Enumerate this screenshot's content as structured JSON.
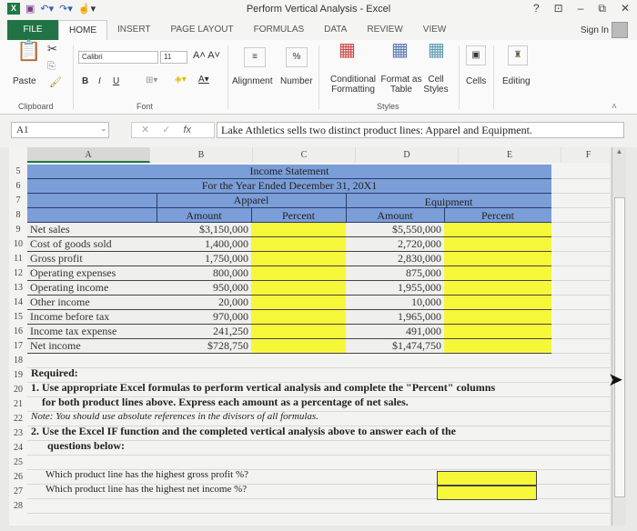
{
  "window": {
    "title": "Perform Vertical Analysis - Excel",
    "controls": [
      "?",
      "⊡",
      "–",
      "⧉",
      "✕"
    ],
    "sign_in": "Sign In"
  },
  "qat": {
    "logo": "X",
    "icons": [
      "save-icon",
      "undo-icon",
      "redo-icon",
      "touch-mode-icon"
    ]
  },
  "tabs": [
    "FILE",
    "HOME",
    "INSERT",
    "PAGE LAYOUT",
    "FORMULAS",
    "DATA",
    "REVIEW",
    "VIEW"
  ],
  "active_tab": "HOME",
  "ribbon": {
    "clipboard": {
      "paste": "Paste",
      "label": "Clipboard"
    },
    "font": {
      "name": "Calibri",
      "size": "11",
      "bold": "B",
      "italic": "I",
      "underline": "U",
      "label": "Font"
    },
    "alignment": "Alignment",
    "number": "Number",
    "number_symbol": "%",
    "styles": {
      "conditional": "Conditional Formatting",
      "format_table": "Format as Table",
      "cell_styles": "Cell Styles",
      "label": "Styles"
    },
    "cells": "Cells",
    "editing": "Editing"
  },
  "formula_bar": {
    "name_box": "A1",
    "formula": "Lake Athletics sells two distinct product lines:  Apparel and Equipment.",
    "fx": "fx"
  },
  "columns": [
    "A",
    "B",
    "C",
    "D",
    "E",
    "F"
  ],
  "sheet": {
    "title": "Income Statement",
    "subtitle": "For the Year Ended December 31, 20X1",
    "apparel": "Apparel",
    "equipment": "Equipment",
    "amount_hdr": "Amount",
    "percent_hdr": "Percent",
    "rows": [
      {
        "n": "9",
        "label": "Net sales",
        "apparel": "$3,150,000",
        "equipment": "$5,550,000"
      },
      {
        "n": "10",
        "label": "Cost of goods sold",
        "apparel": "1,400,000",
        "equipment": "2,720,000"
      },
      {
        "n": "11",
        "label": "Gross profit",
        "apparel": "1,750,000",
        "equipment": "2,830,000"
      },
      {
        "n": "12",
        "label": "Operating expenses",
        "apparel": "800,000",
        "equipment": "875,000"
      },
      {
        "n": "13",
        "label": "Operating income",
        "apparel": "950,000",
        "equipment": "1,955,000"
      },
      {
        "n": "14",
        "label": "Other income",
        "apparel": "20,000",
        "equipment": "10,000"
      },
      {
        "n": "15",
        "label": "Income before tax",
        "apparel": "970,000",
        "equipment": "1,965,000"
      },
      {
        "n": "16",
        "label": "Income tax expense",
        "apparel": "241,250",
        "equipment": "491,000"
      },
      {
        "n": "17",
        "label": "Net income",
        "apparel": "$728,750",
        "equipment": "$1,474,750"
      }
    ],
    "required": "Required:",
    "q1a": "1. Use appropriate Excel formulas to perform vertical analysis and complete the \"Percent\" columns",
    "q1b": "for both product lines above.  Express each amount as a percentage of net sales.",
    "note": "Note:  You should use absolute references in the divisors of all formulas.",
    "q2a": "2.  Use the Excel IF function and the completed vertical analysis above to answer each of the",
    "q2b": "questions below:",
    "ask1": "Which product line has the highest gross profit %?",
    "ask2": "Which product line has the highest net income %?"
  },
  "row_numbers": [
    "5",
    "6",
    "7",
    "8",
    "9",
    "10",
    "11",
    "12",
    "13",
    "14",
    "15",
    "16",
    "17",
    "18",
    "19",
    "20",
    "21",
    "22",
    "23",
    "24",
    "25",
    "26",
    "27",
    "28"
  ]
}
